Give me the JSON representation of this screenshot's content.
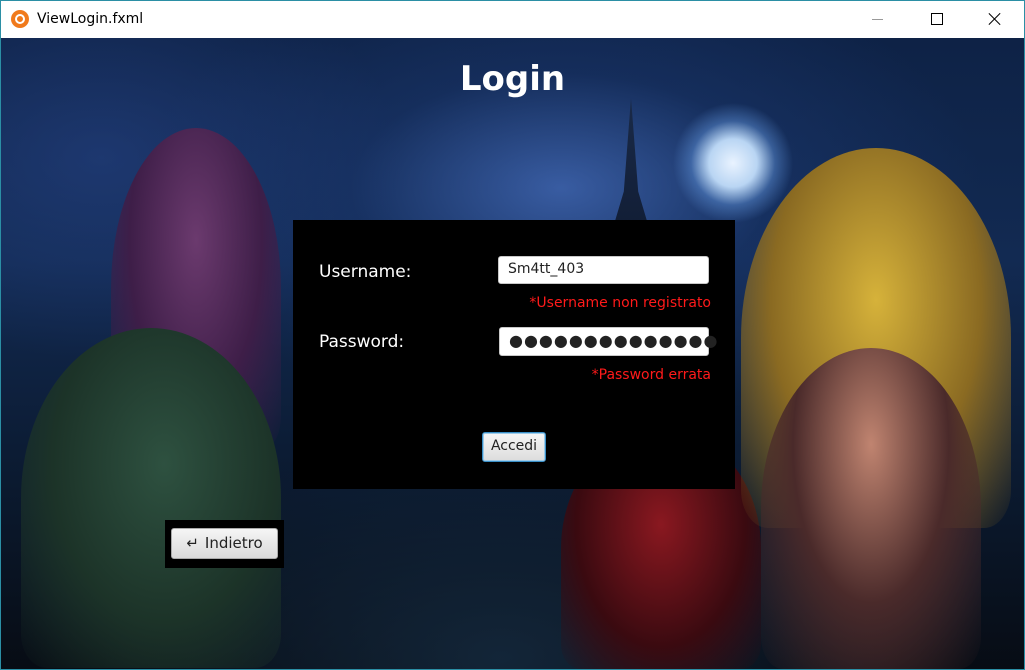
{
  "window": {
    "title": "ViewLogin.fxml"
  },
  "page": {
    "title": "Login"
  },
  "form": {
    "username_label": "Username:",
    "username_value": "Sm4tt_403",
    "username_error": "*Username non registrato",
    "password_label": "Password:",
    "password_value": "●●●●●●●●●●●●●●",
    "password_error": "*Password errata",
    "submit_label": "Accedi"
  },
  "nav": {
    "back_icon": "↵",
    "back_label": "Indietro"
  },
  "colors": {
    "error": "#ff1a1a",
    "panel": "#000000",
    "focus_border": "#3a8fc7"
  }
}
